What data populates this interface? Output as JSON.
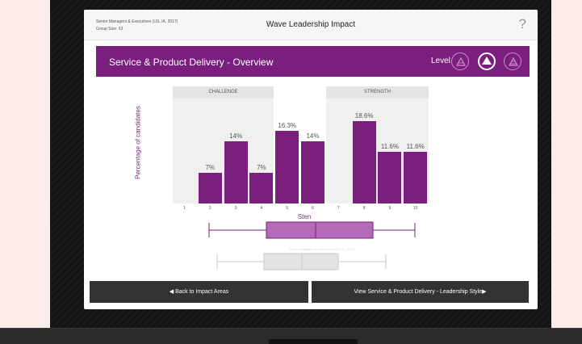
{
  "header": {
    "group_name": "Senior Managers & Executives (US, IA, 2017)",
    "group_size": "Group Size: 63",
    "title": "Wave Leadership Impact",
    "help": "?"
  },
  "banner": {
    "title": "Service & Product Delivery - Overview",
    "level_label": "Level",
    "level_icons": [
      "level-low-icon",
      "level-mid-icon",
      "level-high-icon"
    ]
  },
  "chart_data": {
    "type": "bar",
    "categories": [
      "1",
      "2",
      "3",
      "4",
      "5",
      "6",
      "7",
      "8",
      "9",
      "10"
    ],
    "values": [
      0,
      7,
      14,
      7,
      16.3,
      14,
      0,
      18.6,
      11.6,
      11.6
    ],
    "value_labels": [
      "",
      "7%",
      "14%",
      "7%",
      "16.3%",
      "14%",
      "",
      "18.6%",
      "11.6%",
      "11.6%"
    ],
    "ylabel": "Percentage of candidates",
    "xlabel": "Sten",
    "bands": [
      {
        "label": "CHALLENGE",
        "from": 1,
        "to": 4
      },
      {
        "label": "STRENGTH",
        "from": 7,
        "to": 10
      }
    ],
    "ylim": [
      0,
      20
    ],
    "bar_color": "#7b1f7e"
  },
  "boxplot": {
    "min": 2,
    "q1": 4,
    "median": 5.5,
    "q3": 8,
    "max": 10
  },
  "comparison_box": {
    "label": "Senior Managers & Executives (US, IA, 2017)"
  },
  "footer": {
    "back_label": "◀  Back to Impact Areas",
    "next_label": "View Service & Product Delivery - Leadership Style▶"
  }
}
